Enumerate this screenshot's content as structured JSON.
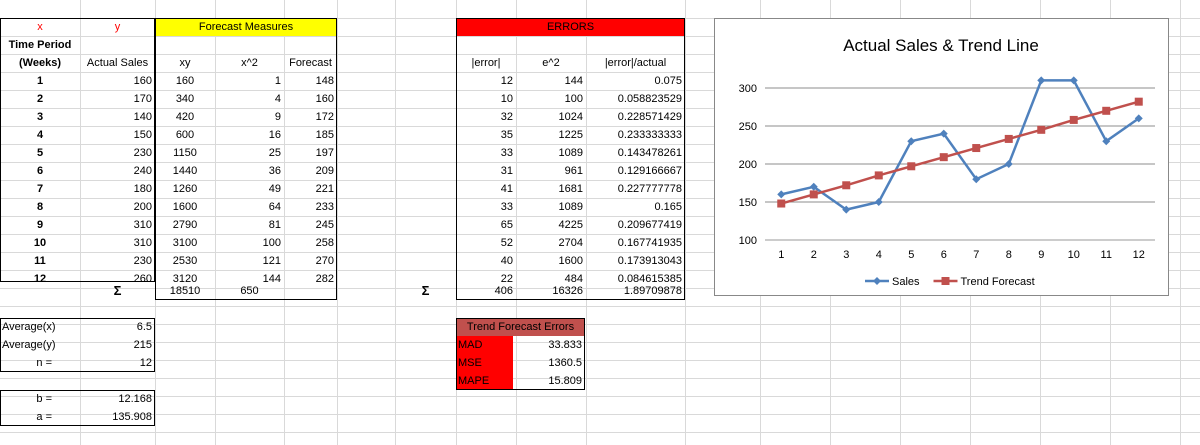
{
  "header": {
    "x_label": "x",
    "y_label": "y",
    "forecast_measures": "Forecast Measures",
    "errors": "ERRORS"
  },
  "columns": {
    "time_period_1": "Time Period",
    "time_period_2": "(Weeks)",
    "actual_sales": "Actual Sales",
    "xy": "xy",
    "x2": "x^2",
    "forecast": "Forecast",
    "abs_error": "|error|",
    "e2": "e^2",
    "err_actual": "|error|/actual"
  },
  "rows": [
    [
      "1",
      "160",
      "160",
      "1",
      "148",
      "12",
      "144",
      "0.075"
    ],
    [
      "2",
      "170",
      "340",
      "4",
      "160",
      "10",
      "100",
      "0.058823529"
    ],
    [
      "3",
      "140",
      "420",
      "9",
      "172",
      "32",
      "1024",
      "0.228571429"
    ],
    [
      "4",
      "150",
      "600",
      "16",
      "185",
      "35",
      "1225",
      "0.233333333"
    ],
    [
      "5",
      "230",
      "1150",
      "25",
      "197",
      "33",
      "1089",
      "0.143478261"
    ],
    [
      "6",
      "240",
      "1440",
      "36",
      "209",
      "31",
      "961",
      "0.129166667"
    ],
    [
      "7",
      "180",
      "1260",
      "49",
      "221",
      "41",
      "1681",
      "0.227777778"
    ],
    [
      "8",
      "200",
      "1600",
      "64",
      "233",
      "33",
      "1089",
      "0.165"
    ],
    [
      "9",
      "310",
      "2790",
      "81",
      "245",
      "65",
      "4225",
      "0.209677419"
    ],
    [
      "10",
      "310",
      "3100",
      "100",
      "258",
      "52",
      "2704",
      "0.167741935"
    ],
    [
      "11",
      "230",
      "2530",
      "121",
      "270",
      "40",
      "1600",
      "0.173913043"
    ],
    [
      "12",
      "260",
      "3120",
      "144",
      "282",
      "22",
      "484",
      "0.084615385"
    ]
  ],
  "sums": {
    "sigma1": "Σ",
    "xy": "18510",
    "x2": "650",
    "sigma2": "Σ",
    "abs_error": "406",
    "e2": "16326",
    "err_actual": "1.89709878"
  },
  "stats": {
    "avg_x_label": "Average(x)",
    "avg_x": "6.5",
    "avg_y_label": "Average(y)",
    "avg_y": "215",
    "n_label": "n =",
    "n": "12",
    "b_label": "b =",
    "b": "12.168",
    "a_label": "a =",
    "a": "135.908"
  },
  "trend_errors": {
    "title": "Trend Forecast Errors",
    "mad_label": "MAD",
    "mad": "33.833",
    "mse_label": "MSE",
    "mse": "1360.5",
    "mape_label": "MAPE",
    "mape": "15.809"
  },
  "colors": {
    "yellow": "#ffff00",
    "red": "#ff0000",
    "red_header": "#c0504d",
    "sales": "#4f81bd",
    "trend": "#c0504d"
  },
  "chart_data": {
    "type": "line",
    "title": "Actual Sales & Trend Line",
    "categories": [
      "1",
      "2",
      "3",
      "4",
      "5",
      "6",
      "7",
      "8",
      "9",
      "10",
      "11",
      "12"
    ],
    "series": [
      {
        "name": "Sales",
        "values": [
          160,
          170,
          140,
          150,
          230,
          240,
          180,
          200,
          310,
          310,
          230,
          260
        ],
        "color": "#4f81bd",
        "marker": "diamond"
      },
      {
        "name": "Trend Forecast",
        "values": [
          148,
          160,
          172,
          185,
          197,
          209,
          221,
          233,
          245,
          258,
          270,
          282
        ],
        "color": "#c0504d",
        "marker": "square"
      }
    ],
    "yticks": [
      "100",
      "150",
      "200",
      "250",
      "300"
    ],
    "ylim": [
      100,
      300
    ],
    "grid": true,
    "legend": "bottom"
  }
}
